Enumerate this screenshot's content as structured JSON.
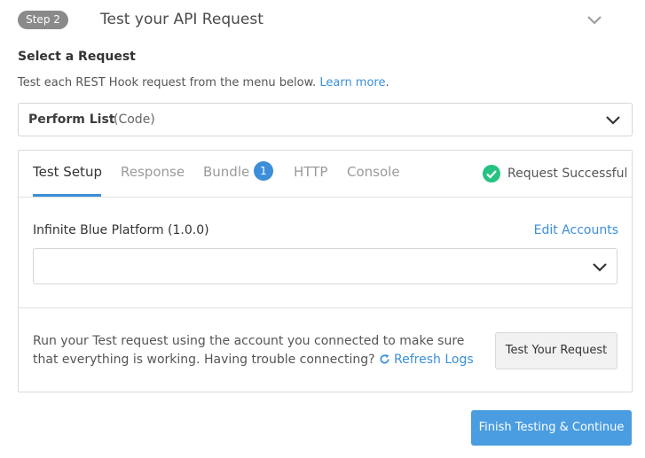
{
  "step": {
    "badge": "Step 2",
    "title": "Test your API Request"
  },
  "request": {
    "label": "Select a Request",
    "help_text": "Test each REST Hook request from the menu below.",
    "learn_more": "Learn more",
    "learn_more_suffix": ".",
    "selected_name": "Perform List",
    "selected_type": "(Code)"
  },
  "tabs": [
    {
      "label": "Test Setup",
      "active": true
    },
    {
      "label": "Response"
    },
    {
      "label": "Bundle",
      "badge": "1"
    },
    {
      "label": "HTTP"
    },
    {
      "label": "Console"
    }
  ],
  "status": {
    "text": "Request Successful",
    "color": "#26c281"
  },
  "account": {
    "label": "Infinite Blue Platform (1.0.0)",
    "edit_link": "Edit Accounts",
    "selected_value": ""
  },
  "run": {
    "text": "Run your Test request using the account you connected to make sure that everything is working. Having trouble connecting?",
    "refresh_logs": "Refresh Logs",
    "test_button": "Test Your Request"
  },
  "footer": {
    "finish_button": "Finish Testing & Continue"
  },
  "colors": {
    "accent": "#3b8fd8",
    "primary_button": "#4a9de0",
    "badge_gray": "#8a8a8a"
  }
}
